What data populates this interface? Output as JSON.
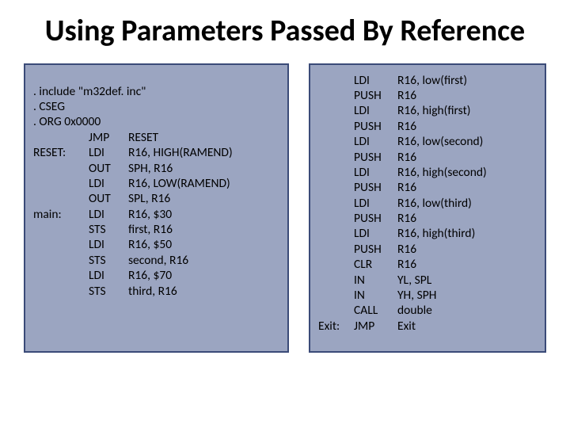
{
  "title": "Using Parameters Passed By Reference",
  "left": {
    "header": [
      ". include \"m32def. inc\"",
      ". CSEG",
      ". ORG   0x0000"
    ],
    "rows": [
      {
        "label": "",
        "op": "JMP",
        "arg": "RESET"
      },
      {
        "label": "RESET:",
        "op": "LDI",
        "arg": "R16, HIGH(RAMEND)"
      },
      {
        "label": "",
        "op": "OUT",
        "arg": "SPH, R16"
      },
      {
        "label": "",
        "op": "LDI",
        "arg": "R16, LOW(RAMEND)"
      },
      {
        "label": "",
        "op": "OUT",
        "arg": "SPL, R16"
      },
      {
        "label": "main:",
        "op": "LDI",
        "arg": "R16, $30"
      },
      {
        "label": "",
        "op": "STS",
        "arg": "first, R16"
      },
      {
        "label": "",
        "op": "LDI",
        "arg": "R16, $50"
      },
      {
        "label": "",
        "op": "STS",
        "arg": "second, R16"
      },
      {
        "label": "",
        "op": "LDI",
        "arg": "R16, $70"
      },
      {
        "label": "",
        "op": "STS",
        "arg": "third, R16"
      }
    ]
  },
  "right": {
    "rows": [
      {
        "label": "",
        "op": "LDI",
        "arg": "R16, low(first)"
      },
      {
        "label": "",
        "op": "PUSH",
        "arg": "R16"
      },
      {
        "label": "",
        "op": "LDI",
        "arg": "R16, high(first)"
      },
      {
        "label": "",
        "op": "PUSH",
        "arg": "R16"
      },
      {
        "label": "",
        "op": "LDI",
        "arg": "R16, low(second)"
      },
      {
        "label": "",
        "op": "PUSH",
        "arg": "R16"
      },
      {
        "label": "",
        "op": "LDI",
        "arg": "R16, high(second)"
      },
      {
        "label": "",
        "op": "PUSH",
        "arg": "R16"
      },
      {
        "label": "",
        "op": "LDI",
        "arg": "R16, low(third)"
      },
      {
        "label": "",
        "op": "PUSH",
        "arg": "R16"
      },
      {
        "label": "",
        "op": "LDI",
        "arg": "R16, high(third)"
      },
      {
        "label": "",
        "op": "PUSH",
        "arg": "R16"
      },
      {
        "label": "",
        "op": "CLR",
        "arg": "R16"
      },
      {
        "label": "",
        "op": "IN",
        "arg": "YL, SPL"
      },
      {
        "label": "",
        "op": "IN",
        "arg": "YH, SPH"
      },
      {
        "label": "",
        "op": "CALL",
        "arg": "double"
      },
      {
        "label": "Exit:",
        "op": "JMP",
        "arg": "Exit"
      }
    ]
  }
}
